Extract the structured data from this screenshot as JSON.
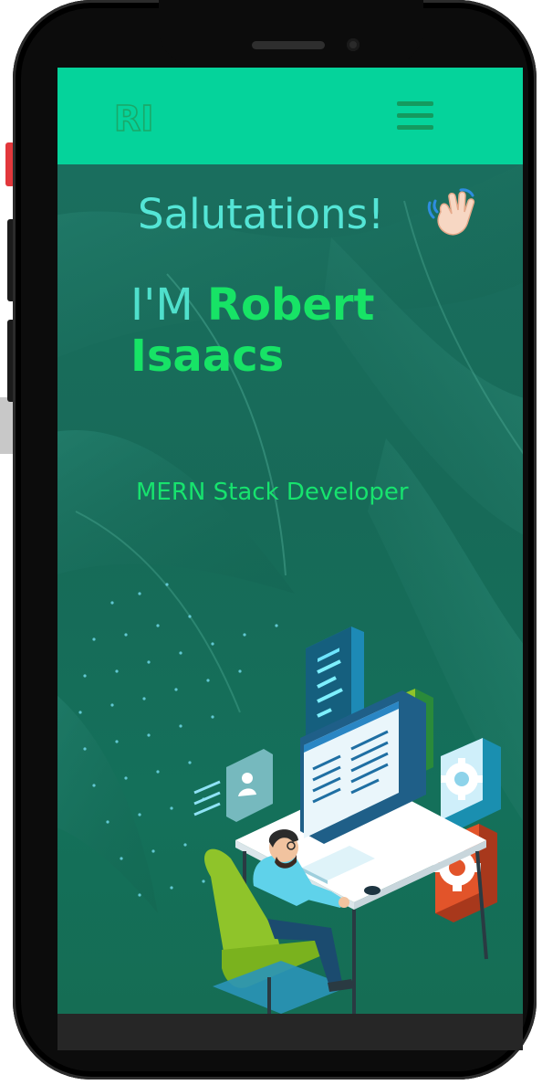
{
  "header": {
    "logo_text": "RI",
    "menu_icon": "hamburger-menu-icon"
  },
  "hero": {
    "greeting": "Salutations!",
    "greeting_icon": "waving-hand-icon",
    "name_prefix": "I'M",
    "first_name": "Robert",
    "last_name": "Isaacs",
    "role": "MERN Stack Developer",
    "illustration": "developer-at-computer-illustration"
  },
  "colors": {
    "header_bg": "#05d39b",
    "accent_green": "#17e366",
    "greeting_cyan": "#54e5d6",
    "hero_bg": "#1a6e5e"
  }
}
